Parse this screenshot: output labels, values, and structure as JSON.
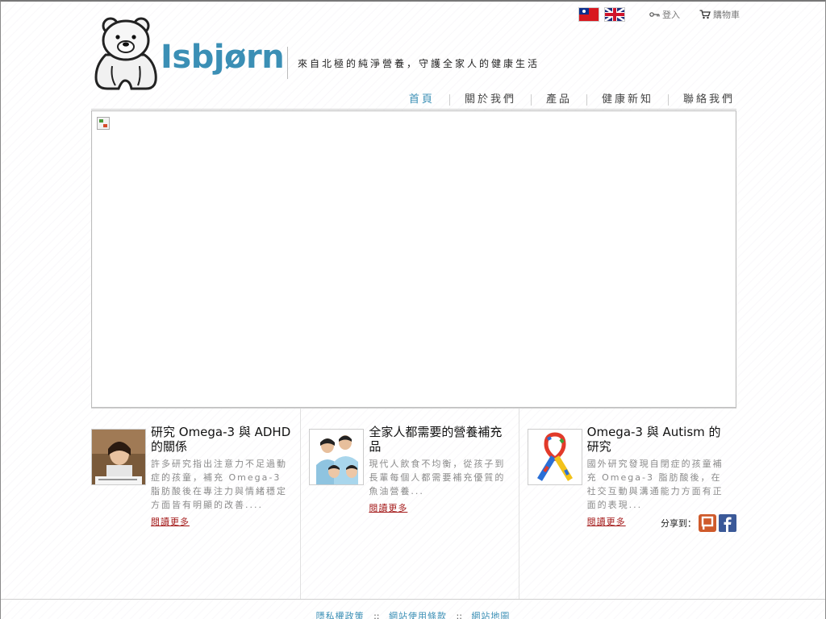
{
  "utility": {
    "lang_tw": "繁體中文",
    "lang_en": "English",
    "login_label": "登入",
    "cart_label": "購物車"
  },
  "header": {
    "brand": "Isbjørn",
    "tagline": "來自北極的純淨營養，守護全家人的健康生活"
  },
  "nav": {
    "items": [
      {
        "label": "首頁",
        "active": true
      },
      {
        "label": "關於我們",
        "active": false
      },
      {
        "label": "產品",
        "active": false
      },
      {
        "label": "健康新知",
        "active": false
      },
      {
        "label": "聯絡我們",
        "active": false
      }
    ]
  },
  "articles": [
    {
      "title": "研究 Omega-3 與 ADHD 的關係",
      "excerpt": "許多研究指出注意力不足過動症的孩童，補充 Omega-3 脂肪酸後在專注力與情緒穩定方面皆有明顯的改善....",
      "more": "閱讀更多"
    },
    {
      "title": "全家人都需要的營養補充品",
      "excerpt": "現代人飲食不均衡，從孩子到長輩每個人都需要補充優質的魚油營養...",
      "more": "閱讀更多"
    },
    {
      "title": "Omega-3 與 Autism 的研究",
      "excerpt": "國外研究發現自閉症的孩童補充 Omega-3 脂肪酸後，在社交互動與溝通能力方面有正面的表現...",
      "more": "閱讀更多"
    }
  ],
  "share": {
    "label": "分享到："
  },
  "footer": {
    "links": [
      "隱私權政策",
      "網站使用條款",
      "網站地圖"
    ],
    "separator": "::"
  },
  "colors": {
    "accent": "#3b8fb5",
    "link_red": "#a41a1a"
  }
}
